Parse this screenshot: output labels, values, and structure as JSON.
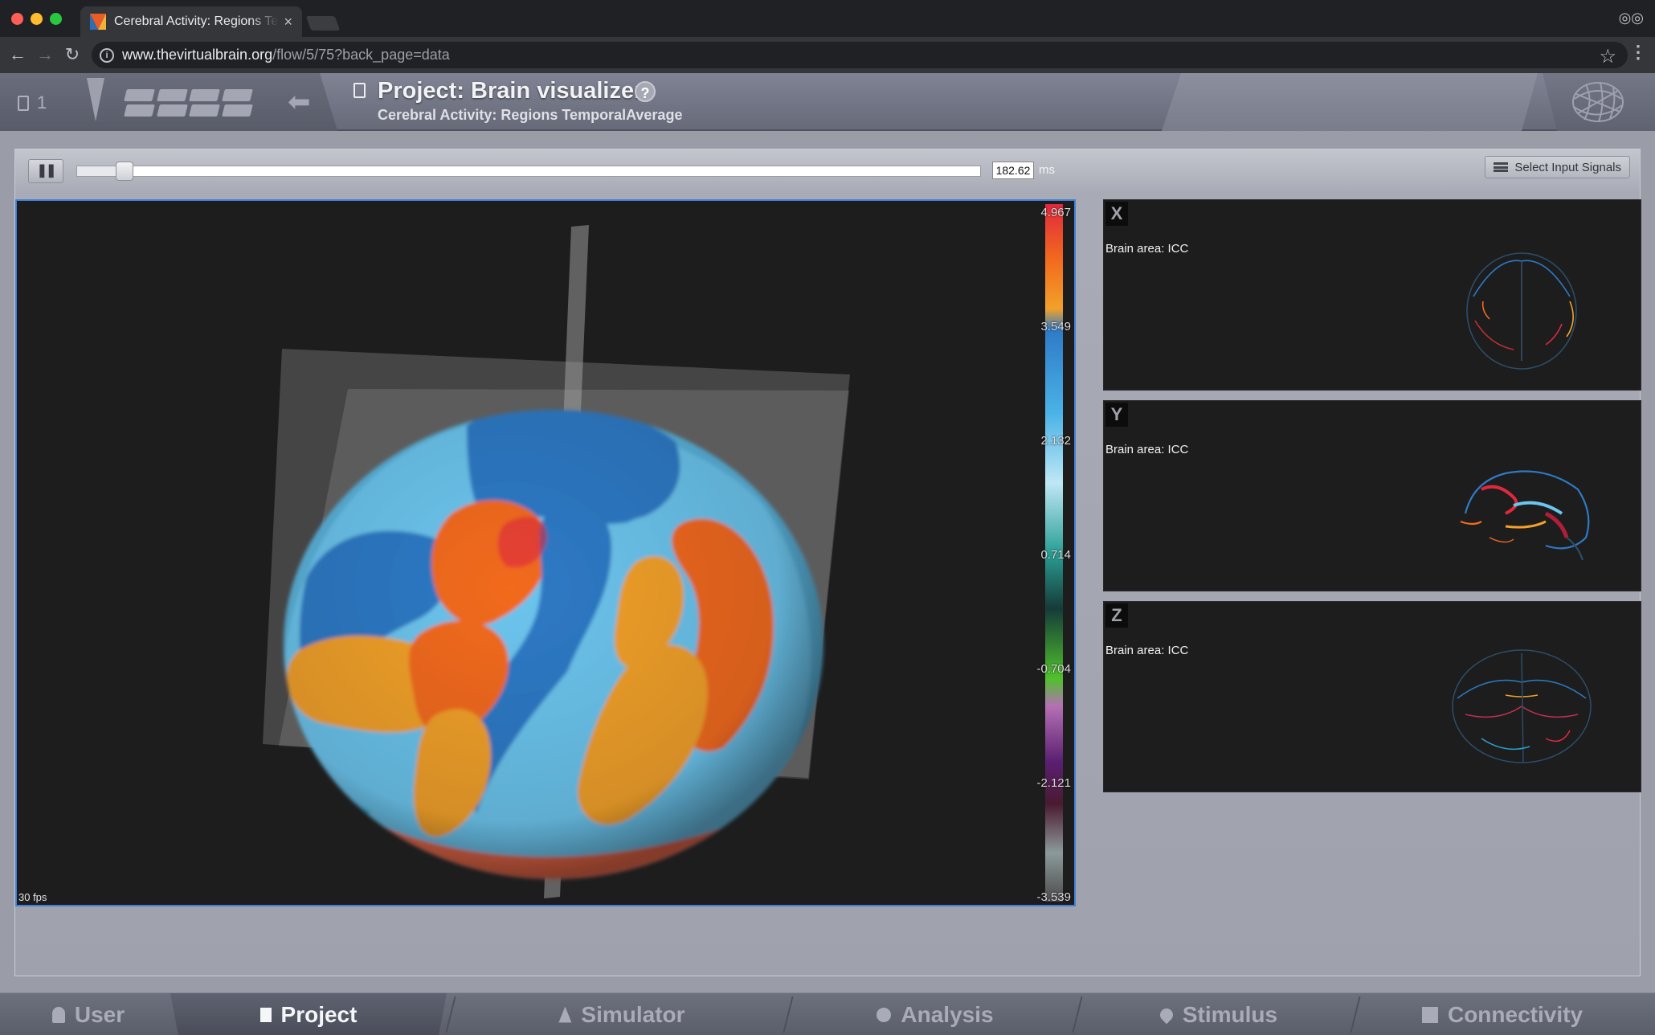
{
  "browser": {
    "tab_title": "Cerebral Activity: Regions TemporalAverage",
    "tab_close": "×",
    "url_host": "www.thevirtualbrain.org",
    "url_path": "/flow/5/75?back_page=data"
  },
  "header": {
    "doc_count": "1",
    "project_title": "Project: Brain visualizer",
    "help": "?",
    "subtitle": "Cerebral Activity: Regions TemporalAverage"
  },
  "controls": {
    "time_value": "182.62",
    "time_unit": "ms",
    "slider_fraction": 0.035,
    "select_signals_label": "Select Input Signals"
  },
  "viewer": {
    "fps": "30 fps",
    "legend_ticks": [
      "4.967",
      "3.549",
      "2.132",
      "0.714",
      "-0.704",
      "-2.121",
      "-3.539"
    ],
    "colors": {
      "red": "#e0283d",
      "orange": "#f26a1e",
      "amber": "#f2a12a",
      "blue": "#2e7ac6",
      "light_blue": "#6cc5ee",
      "teal": "#2a9f95",
      "green": "#4fc12c",
      "purple": "#7a2a86",
      "gray": "#8c9a9b"
    }
  },
  "slices": [
    {
      "axis": "X",
      "area": "Brain area: ICC"
    },
    {
      "axis": "Y",
      "area": "Brain area: ICC"
    },
    {
      "axis": "Z",
      "area": "Brain area: ICC"
    }
  ],
  "bottom_nav": {
    "items": [
      {
        "label": "User",
        "icon": "user-icon"
      },
      {
        "label": "Project",
        "icon": "document-icon",
        "active": true
      },
      {
        "label": "Simulator",
        "icon": "rocket-icon"
      },
      {
        "label": "Analysis",
        "icon": "gear-icon"
      },
      {
        "label": "Stimulus",
        "icon": "pin-icon"
      },
      {
        "label": "Connectivity",
        "icon": "network-icon"
      }
    ]
  }
}
